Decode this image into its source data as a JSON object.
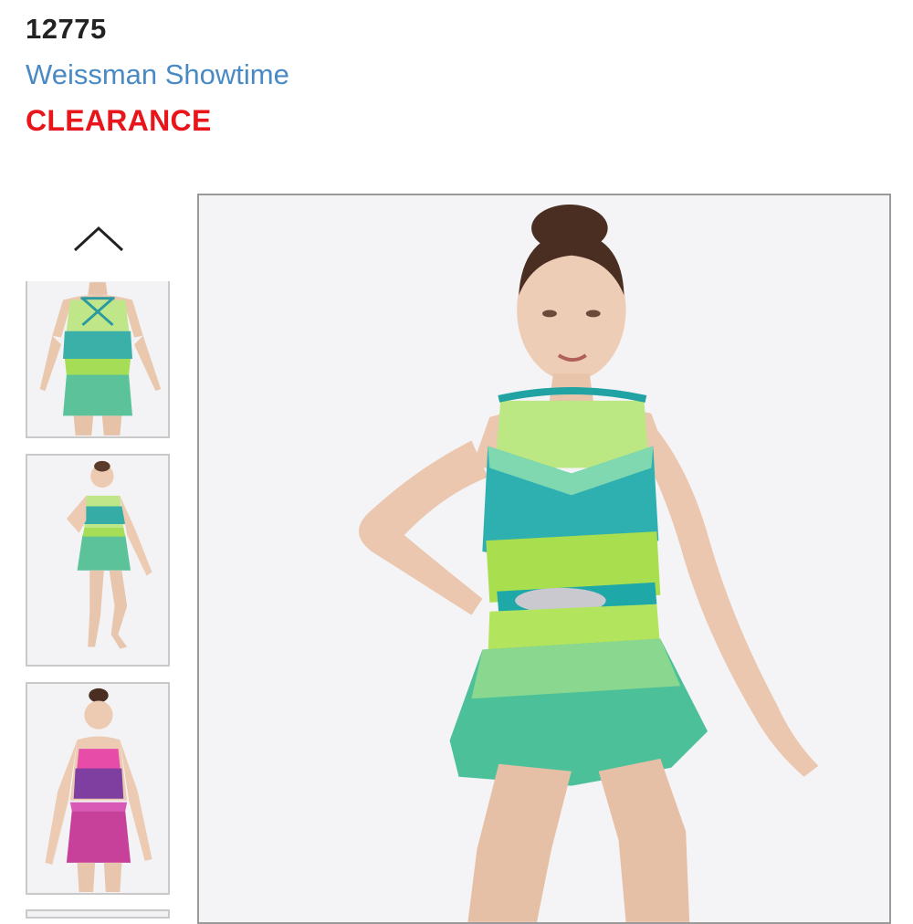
{
  "product": {
    "sku": "12775",
    "brand": "Weissman Showtime",
    "badge": "CLEARANCE"
  },
  "colors": {
    "brand_link": "#4a8ac4",
    "badge_red": "#e8161b",
    "sku_text": "#222222"
  },
  "gallery": {
    "up_icon": "chevron-up-icon",
    "thumbnails": [
      {
        "view": "back",
        "costume_color": "green-turquoise"
      },
      {
        "view": "front-full",
        "costume_color": "green-turquoise"
      },
      {
        "view": "front",
        "costume_color": "pink-purple"
      },
      {
        "view": "partial",
        "costume_color": ""
      }
    ],
    "main_view": "front, green-turquoise fringe costume"
  }
}
